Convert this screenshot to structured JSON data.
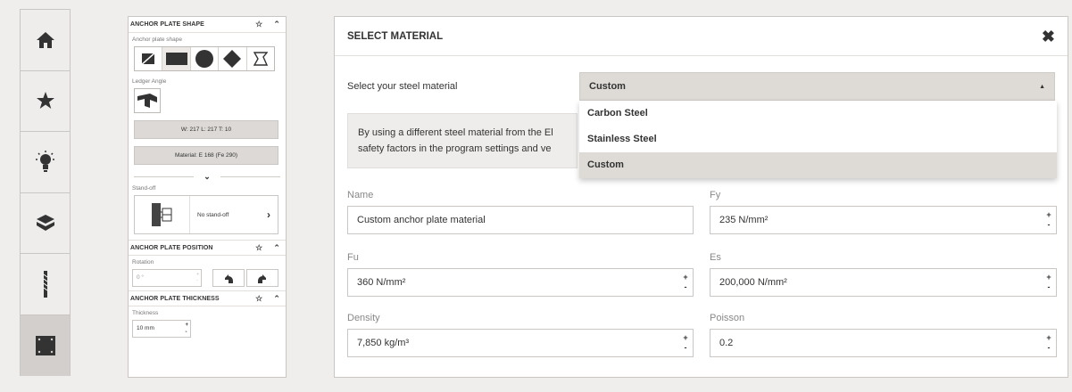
{
  "nav": {
    "items": [
      {
        "icon": "home-icon"
      },
      {
        "icon": "star-icon"
      },
      {
        "icon": "lightbulb-icon"
      },
      {
        "icon": "layers-icon"
      },
      {
        "icon": "anchor-bolt-icon"
      },
      {
        "icon": "anchor-plate-icon",
        "active": true
      }
    ]
  },
  "panel": {
    "shape_section": {
      "title": "ANCHOR PLATE SHAPE",
      "shape_label": "Anchor plate shape",
      "shapes": [
        "custom-shape-icon",
        "rectangle-icon",
        "circle-icon",
        "diamond-icon",
        "polygon-icon"
      ],
      "ledger_label": "Ledger Angle",
      "dims_button": "W: 217 L: 217 T: 10",
      "material_button": "Material: E 168 (Fe 290)",
      "standoff_label": "Stand-off",
      "standoff_value": "No stand-off"
    },
    "position_section": {
      "title": "ANCHOR PLATE POSITION",
      "rotation_label": "Rotation",
      "rotation_value": "0 °"
    },
    "thickness_section": {
      "title": "ANCHOR PLATE THICKNESS",
      "thickness_label": "Thickness",
      "thickness_value": "10 mm"
    }
  },
  "modal": {
    "title": "SELECT MATERIAL",
    "select_label": "Select your steel material",
    "selected_value": "Custom",
    "options": [
      "Carbon Steel",
      "Stainless Steel",
      "Custom"
    ],
    "info_line1": "By using a different steel material from the El",
    "info_line2": "safety factors in the program settings and ve",
    "fields": {
      "name_label": "Name",
      "name_value": "Custom anchor plate material",
      "fy_label": "Fy",
      "fy_value": "235 N/mm²",
      "fu_label": "Fu",
      "fu_value": "360 N/mm²",
      "es_label": "Es",
      "es_value": "200,000 N/mm²",
      "density_label": "Density",
      "density_value": "7,850 kg/m³",
      "poisson_label": "Poisson",
      "poisson_value": "0.2"
    },
    "stepper_plus": "+",
    "stepper_minus": "-"
  }
}
